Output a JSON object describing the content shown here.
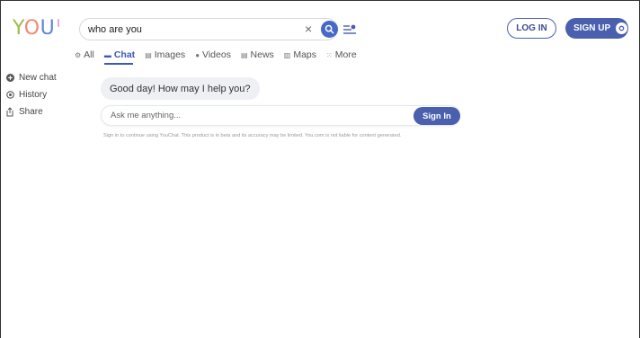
{
  "brand": {
    "logo_text": "YOU"
  },
  "search": {
    "query": "who are you",
    "clear_glyph": "×"
  },
  "auth": {
    "login_label": "LOG IN",
    "signup_label": "SIGN UP"
  },
  "tabs": [
    {
      "label": "All",
      "icon": "all-icon",
      "glyph": "⚙"
    },
    {
      "label": "Chat",
      "icon": "chat-icon",
      "glyph": "▬",
      "active": true
    },
    {
      "label": "Images",
      "icon": "images-icon",
      "glyph": "▤"
    },
    {
      "label": "Videos",
      "icon": "videos-icon",
      "glyph": "●"
    },
    {
      "label": "News",
      "icon": "news-icon",
      "glyph": "▤"
    },
    {
      "label": "Maps",
      "icon": "maps-icon",
      "glyph": "▥"
    },
    {
      "label": "More",
      "icon": "more-icon",
      "glyph": "⁙"
    }
  ],
  "sidebar": {
    "items": [
      {
        "label": "New chat",
        "icon": "plus-circle-icon"
      },
      {
        "label": "History",
        "icon": "history-icon"
      },
      {
        "label": "Share",
        "icon": "share-icon"
      }
    ]
  },
  "chat": {
    "greeting": "Good day! How may I help you?",
    "placeholder": "Ask me anything...",
    "signin_label": "Sign In",
    "disclaimer": "Sign in to continue using YouChat. This product is in beta and its accuracy may be limited. You.com is not liable for content generated."
  },
  "colors": {
    "accent": "#4a5fae",
    "tab_active": "#3d58b8"
  }
}
